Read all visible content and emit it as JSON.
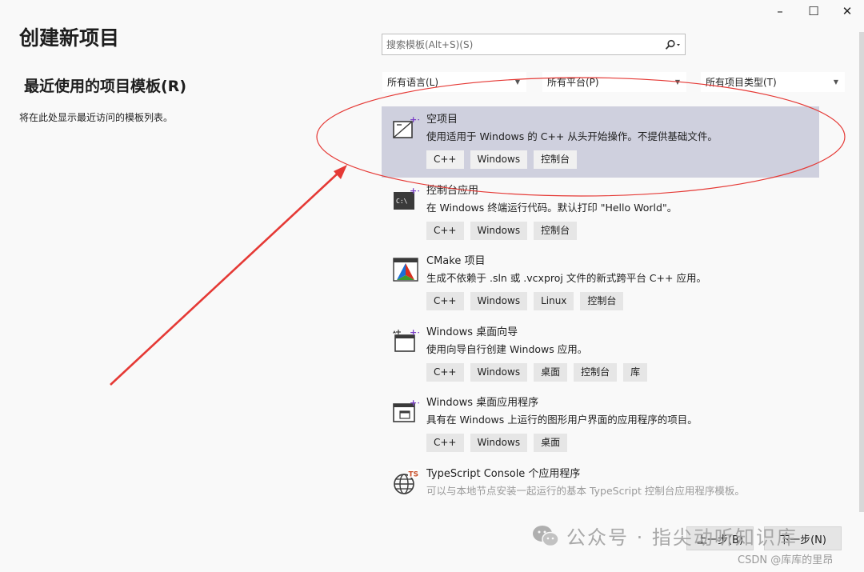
{
  "window": {
    "controls": [
      "–",
      "☐",
      "✕"
    ]
  },
  "page_title": "创建新项目",
  "recent": {
    "title": "最近使用的项目模板(R)",
    "empty_text": "将在此处显示最近访问的模板列表。"
  },
  "search": {
    "placeholder": "搜索模板(Alt+S)(S)",
    "icon": "search-icon"
  },
  "filters": [
    {
      "label": "所有语言(L)"
    },
    {
      "label": "所有平台(P)"
    },
    {
      "label": "所有项目类型(T)"
    }
  ],
  "templates": [
    {
      "name": "空项目",
      "description": "使用适用于 Windows 的 C++ 从头开始操作。不提供基础文件。",
      "tags": [
        "C++",
        "Windows",
        "控制台"
      ],
      "icon": "empty-project-icon",
      "selected": true
    },
    {
      "name": "控制台应用",
      "description": "在 Windows 终端运行代码。默认打印 \"Hello World\"。",
      "tags": [
        "C++",
        "Windows",
        "控制台"
      ],
      "icon": "console-app-icon"
    },
    {
      "name": "CMake 项目",
      "description": "生成不依赖于 .sln 或 .vcxproj 文件的新式跨平台 C++ 应用。",
      "tags": [
        "C++",
        "Windows",
        "Linux",
        "控制台"
      ],
      "icon": "cmake-icon"
    },
    {
      "name": "Windows 桌面向导",
      "description": "使用向导自行创建 Windows 应用。",
      "tags": [
        "C++",
        "Windows",
        "桌面",
        "控制台",
        "库"
      ],
      "icon": "desktop-wizard-icon"
    },
    {
      "name": "Windows 桌面应用程序",
      "description": "具有在 Windows 上运行的图形用户界面的应用程序的项目。",
      "tags": [
        "C++",
        "Windows",
        "桌面"
      ],
      "icon": "desktop-app-icon"
    },
    {
      "name": "TypeScript Console 个应用程序",
      "description": "可以与本地节点安装一起运行的基本 TypeScript 控制台应用程序模板。",
      "tags": [],
      "icon": "typescript-globe-icon",
      "faded": true
    }
  ],
  "footer": {
    "back_label": "上一步(B)",
    "next_label": "下一步(N)"
  },
  "watermark": {
    "text": "公众号 · 指尖动听知识库",
    "csdn": "CSDN @库库的里昂"
  },
  "colors": {
    "selected_bg": "#cfd0de",
    "annotation_red": "#e53935",
    "vs_purple": "#7a3fc7"
  }
}
